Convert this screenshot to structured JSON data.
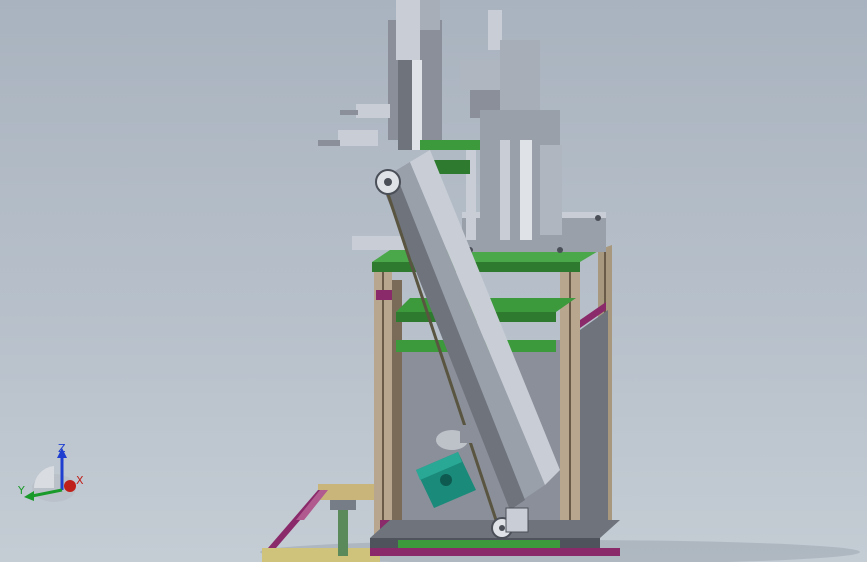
{
  "viewport": {
    "background_top": "#a9b3bf",
    "background_bottom": "#c4ccd4"
  },
  "triad": {
    "z_label": "Z",
    "y_label": "Y",
    "x_label": "X",
    "z_color": "#1f3fd0",
    "y_color": "#1a9a2a",
    "x_color": "#c0201a"
  },
  "model": {
    "frame_color": "#b8a68e",
    "panel_color": "#8a8f99",
    "green_color": "#3c9a3c",
    "magenta_color": "#8a2a6a",
    "motor_color": "#1a8a7a",
    "icon": "cad-assembly-icon"
  }
}
